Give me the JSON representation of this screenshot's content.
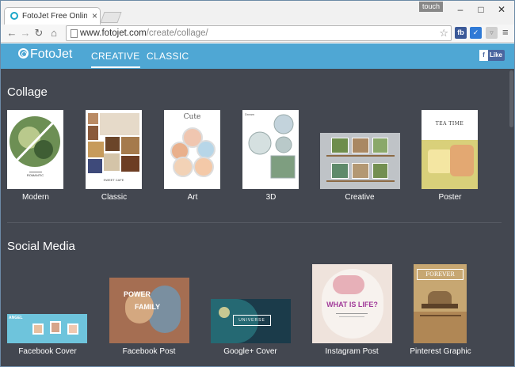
{
  "browser": {
    "tab_title": "FotoJet Free Online Photo",
    "tab_close": "×",
    "touch_label": "touch",
    "url_host": "www.fotojet.com",
    "url_path": "/create/collage/",
    "ext_fb": "fb",
    "window_controls": {
      "minimize": "–",
      "maximize": "□",
      "close": "✕"
    }
  },
  "app": {
    "logo": "FotoJet",
    "nav": [
      "CREATIVE",
      "CLASSIC"
    ],
    "fb_like": "Like",
    "fb_f": "f"
  },
  "sections": [
    {
      "title": "Collage",
      "items": [
        {
          "label": "Modern",
          "thumb_text": "ROMANTIC"
        },
        {
          "label": "Classic",
          "thumb_text": "SWEET CAFE"
        },
        {
          "label": "Art",
          "thumb_text": "Cute"
        },
        {
          "label": "3D",
          "thumb_text": "Dream"
        },
        {
          "label": "Creative"
        },
        {
          "label": "Poster",
          "thumb_text": "TEA TIME"
        }
      ]
    },
    {
      "title": "Social Media",
      "items": [
        {
          "label": "Facebook Cover",
          "thumb_text": "ANGEL"
        },
        {
          "label": "Facebook Post",
          "thumb_text": "POWER",
          "thumb_text2": "FAMILY"
        },
        {
          "label": "Google+ Cover",
          "thumb_text": "UNIVERSE"
        },
        {
          "label": "Instagram Post",
          "thumb_text": "WHAT IS LIFE?"
        },
        {
          "label": "Pinterest Graphic",
          "thumb_text": "FOREVER"
        }
      ]
    }
  ],
  "colors": {
    "header": "#4fa7d4",
    "content_bg": "#434750"
  }
}
